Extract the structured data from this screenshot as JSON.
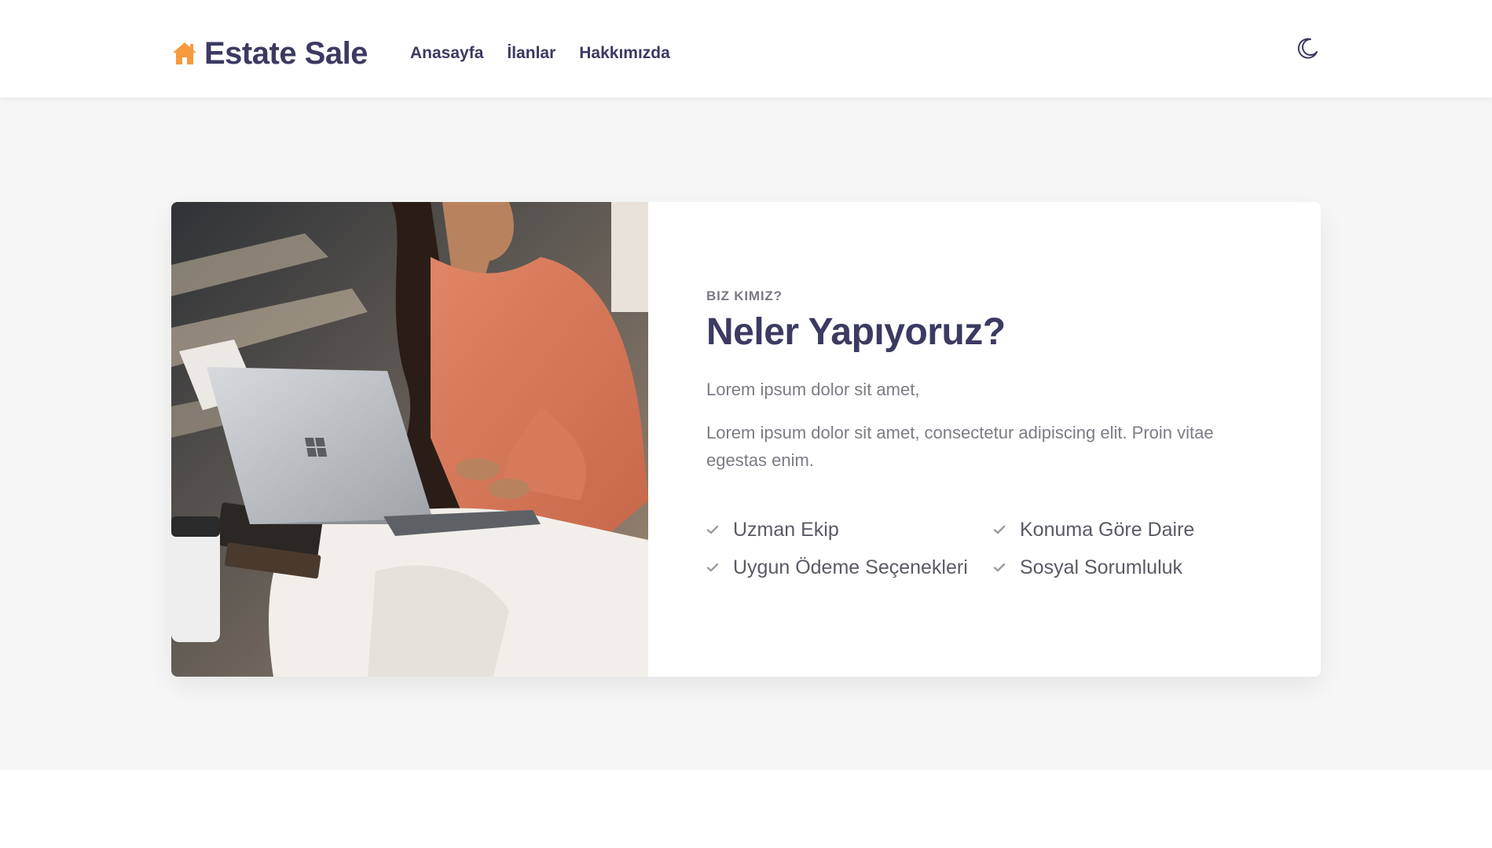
{
  "header": {
    "brand_icon": "home-icon",
    "brand": "Estate Sale",
    "nav": [
      {
        "label": "Anasayfa"
      },
      {
        "label": "İlanlar"
      },
      {
        "label": "Hakkımızda"
      }
    ],
    "theme_toggle_icon": "moon-icon"
  },
  "about": {
    "image_icon": "woman-with-laptop-photo",
    "eyebrow": "BIZ KIMIZ?",
    "title": "Neler Yapıyoruz?",
    "paragraph1": "Lorem ipsum dolor sit amet,",
    "paragraph2": "Lorem ipsum dolor sit amet, consectetur adipiscing elit. Proin vitae egestas enim.",
    "features": [
      {
        "icon": "check-icon",
        "label": "Uzman Ekip"
      },
      {
        "icon": "check-icon",
        "label": "Konuma Göre Daire"
      },
      {
        "icon": "check-icon",
        "label": "Uygun Ödeme Seçenekleri"
      },
      {
        "icon": "check-icon",
        "label": "Sosyal Sorumluluk"
      }
    ]
  },
  "colors": {
    "brand_orange": "#f79a3e",
    "primary_text": "#3b3a62",
    "muted_text": "#7c7c86",
    "section_bg": "#f6f6f6"
  }
}
